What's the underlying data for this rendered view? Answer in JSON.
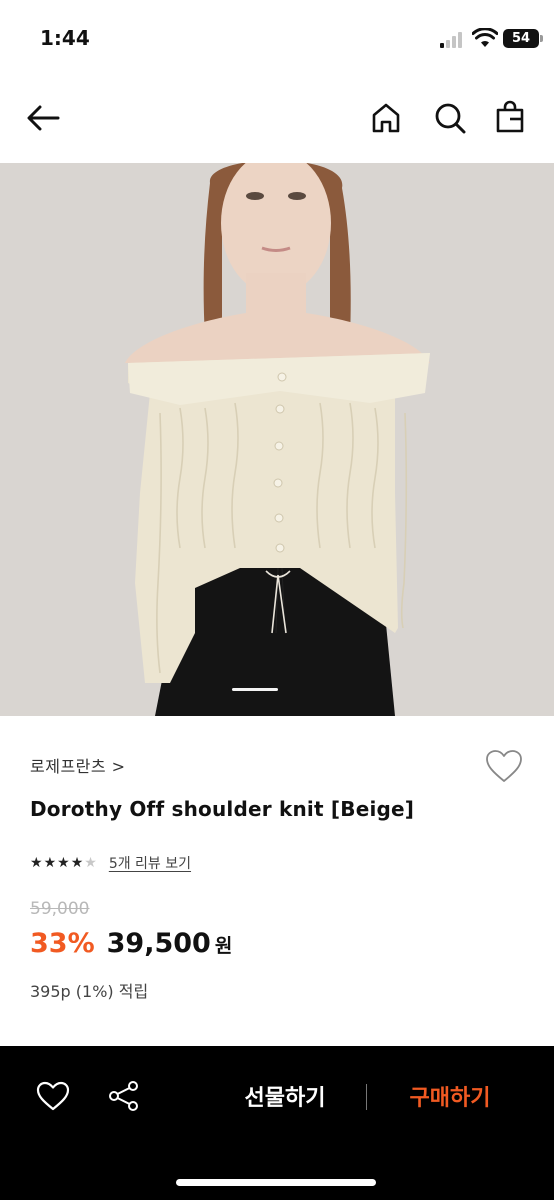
{
  "status_bar": {
    "time": "1:44",
    "battery": "54"
  },
  "nav": {
    "back_icon": "arrow-left-icon",
    "home_icon": "home-icon",
    "search_icon": "search-icon",
    "bag_icon": "shopping-bag-icon"
  },
  "product": {
    "brand": "로제프란츠 >",
    "title": "Dorothy Off shoulder knit [Beige]",
    "rating": 4,
    "rating_max": 5,
    "review_link": "5개 리뷰 보기",
    "original_price": "59,000",
    "discount": "33%",
    "sale_price": "39,500",
    "currency": "원",
    "points": "395p (1%) 적립"
  },
  "bottom_bar": {
    "gift_label": "선물하기",
    "buy_label": "구매하기"
  },
  "colors": {
    "accent": "#f15a22",
    "bottom_bar_bg": "#000000",
    "image_bg": "#d7d3cf"
  }
}
